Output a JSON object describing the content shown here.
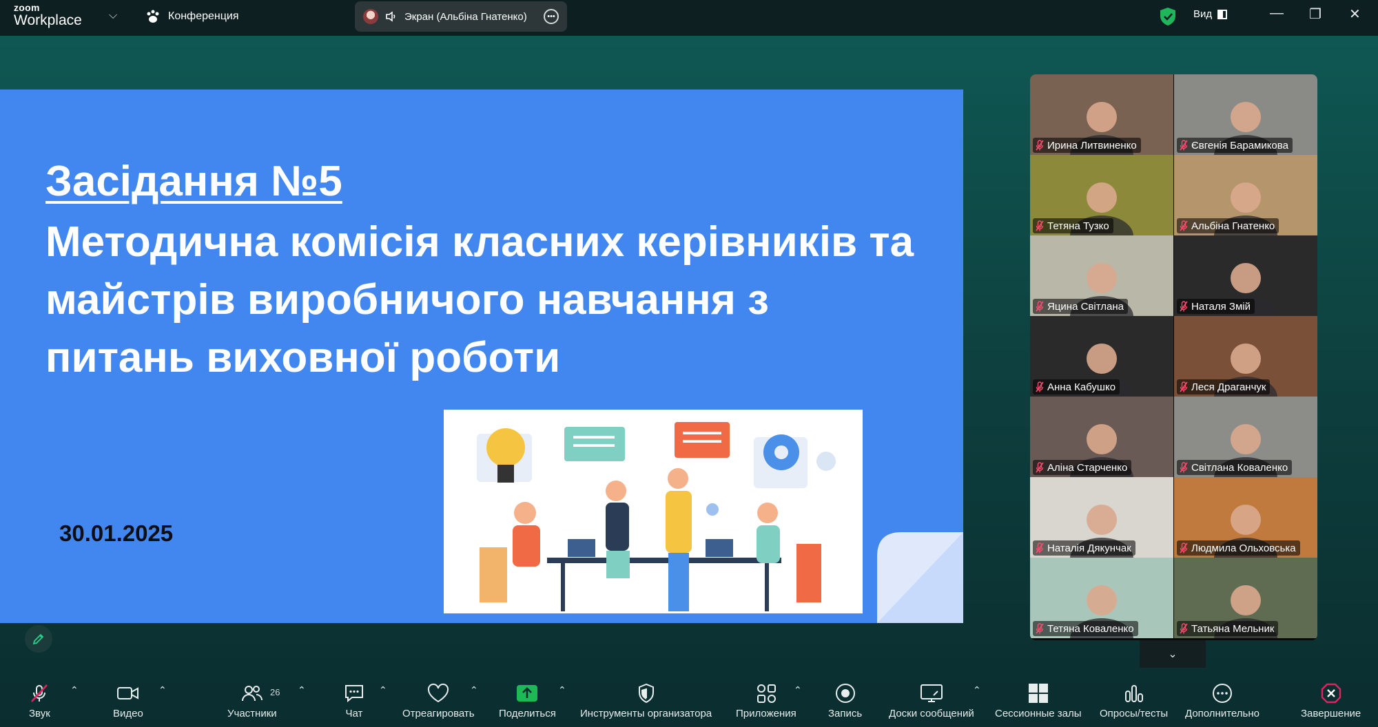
{
  "app": {
    "logo_line1": "zoom",
    "logo_line2": "Workplace"
  },
  "header": {
    "meeting_label": "Конференция",
    "share_label": "Экран (Альбіна Гнатенко)",
    "view_label": "Вид"
  },
  "slide": {
    "title": "Засідання №5",
    "subtitle": "Методична комісія класних керівників та майстрів виробничого навчання з питань виховної роботи",
    "date": "30.01.2025"
  },
  "gallery": {
    "participants": [
      {
        "name": "Ирина Литвиненко",
        "tone": "#7a6252"
      },
      {
        "name": "Євгенія Барамикова",
        "tone": "#8a8a86"
      },
      {
        "name": "Тетяна Тузко",
        "tone": "#8c8a3a"
      },
      {
        "name": "Альбіна Гнатенко",
        "tone": "#b5956b",
        "active": true
      },
      {
        "name": "Яцина Світлана",
        "tone": "#b9b7a8"
      },
      {
        "name": "Наталя Змій",
        "tone": "#2a2a2a"
      },
      {
        "name": "Анна Кабушко",
        "tone": "#2a2a2a"
      },
      {
        "name": "Леся Драганчук",
        "tone": "#7a5038"
      },
      {
        "name": "Аліна Старченко",
        "tone": "#6a5a56"
      },
      {
        "name": "Світлана Коваленко",
        "tone": "#8c8c88"
      },
      {
        "name": "Наталія Дякунчак",
        "tone": "#d8d6cf"
      },
      {
        "name": "Людмила Ольховська",
        "tone": "#c07a3e"
      },
      {
        "name": "Тетяна  Коваленко",
        "tone": "#a9c6ba"
      },
      {
        "name": "Татьяна Мельник",
        "tone": "#5f6c52"
      }
    ]
  },
  "toolbar": {
    "items": [
      {
        "key": "audio",
        "label": "Звук"
      },
      {
        "key": "video",
        "label": "Видео"
      },
      {
        "key": "participants",
        "label": "Участники",
        "count": "26"
      },
      {
        "key": "chat",
        "label": "Чат"
      },
      {
        "key": "react",
        "label": "Отреагировать"
      },
      {
        "key": "share",
        "label": "Поделиться"
      },
      {
        "key": "host",
        "label": "Инструменты организатора"
      },
      {
        "key": "apps",
        "label": "Приложения"
      },
      {
        "key": "record",
        "label": "Запись"
      },
      {
        "key": "whiteboards",
        "label": "Доски сообщений"
      },
      {
        "key": "breakout",
        "label": "Сессионные залы"
      },
      {
        "key": "polls",
        "label": "Опросы/тесты"
      },
      {
        "key": "more",
        "label": "Дополнительно"
      },
      {
        "key": "end",
        "label": "Завершение"
      }
    ]
  },
  "colors": {
    "background": "#0f5a55",
    "slide_blue": "#4287f0",
    "active_speaker": "#23d98b",
    "share_green": "#1db954",
    "end_red": "#e0245e"
  }
}
